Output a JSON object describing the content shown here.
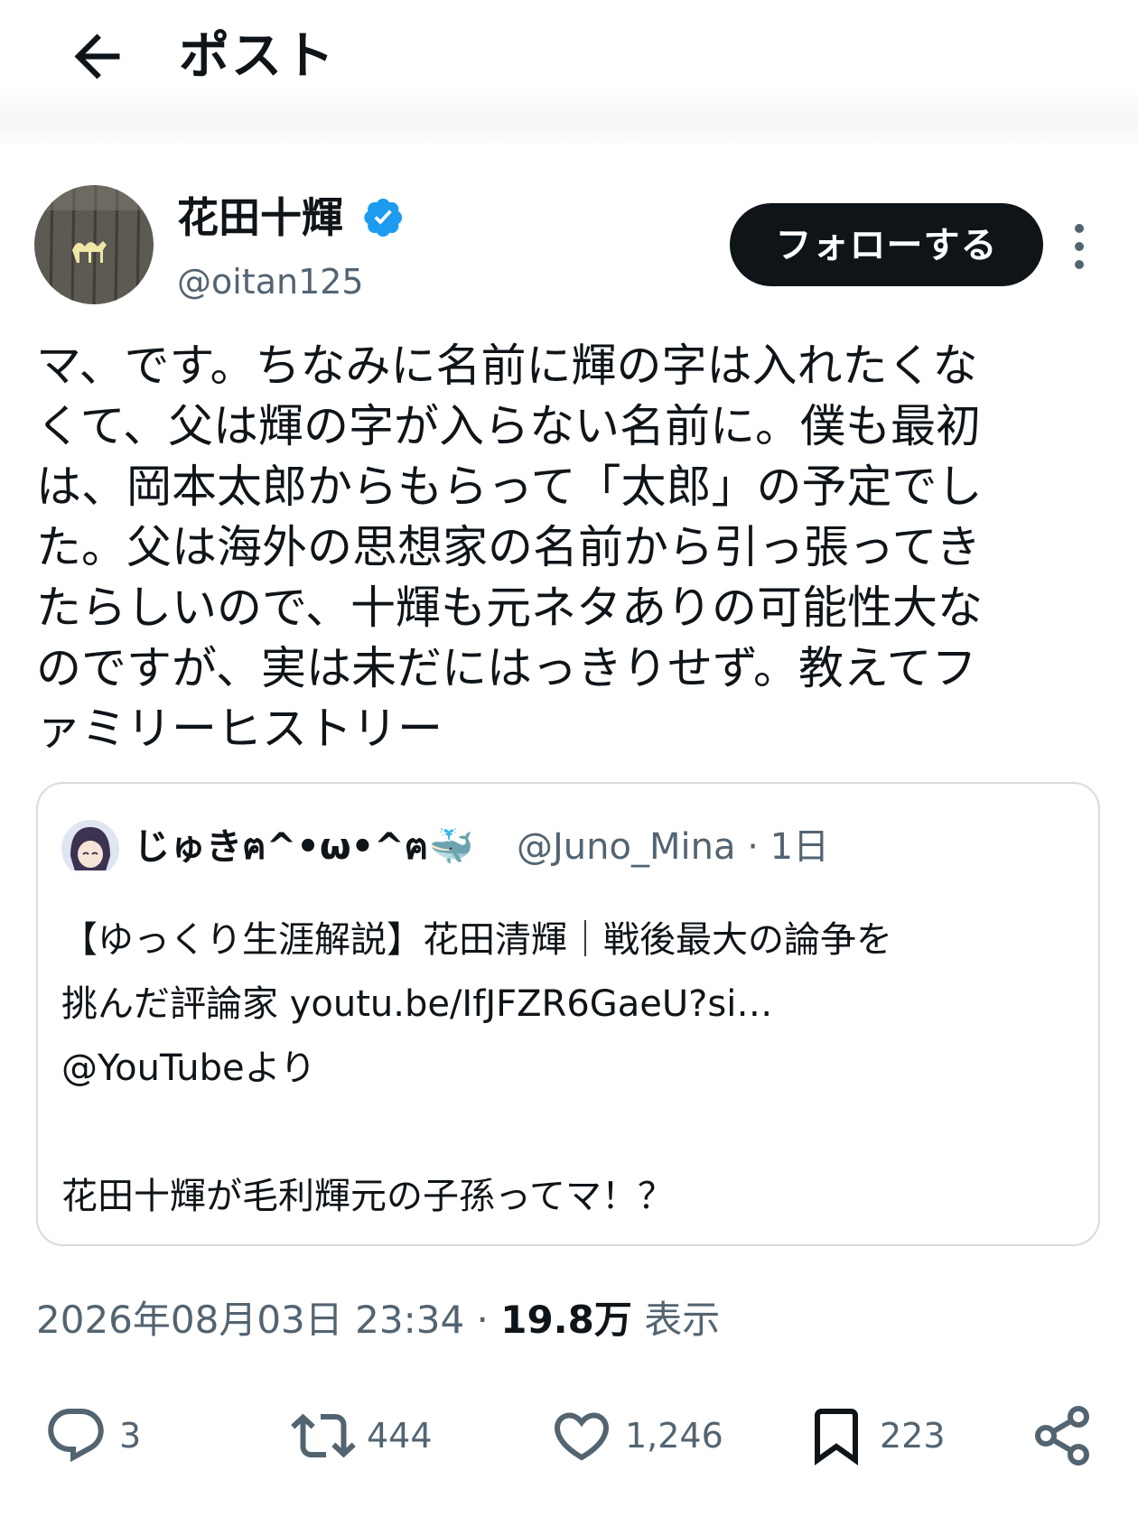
{
  "header": {
    "title": "ポスト"
  },
  "author": {
    "name": "花田十輝",
    "handle": "@oitan125",
    "follow_label": "フォローする"
  },
  "post": {
    "text": "マ、です。ちなみに名前に輝の字は入れたくな\nくて、父は輝の字が入らない名前に。僕も最初\nは、岡本太郎からもらって「太郎」の予定でし\nた。父は海外の思想家の名前から引っ張ってき\nたらしいので、十輝も元ネタありの可能性大な\nのですが、実は未だにはっきりせず。教えてフ\nァミリーヒストリー",
    "date": "2026年08月03日 23:34",
    "views_count": "19.8万",
    "views_label": "表示"
  },
  "quoted": {
    "name": "じゅきฅ^•ω•^ฅ🐳",
    "handle": "@Juno_Mina",
    "time": "1日",
    "text": "【ゆっくり生涯解説】花田清輝｜戦後最大の論争を\n挑んだ評論家 youtu.be/IfJFZR6GaeU?si…\n@YouTubeより\n\n花田十輝が毛利輝元の子孫ってマ！？"
  },
  "actions": {
    "replies": "3",
    "reposts": "444",
    "likes": "1,246",
    "bookmarks": "223"
  },
  "colors": {
    "text": "#0f1419",
    "muted": "#536471",
    "verified": "#1d9bf0"
  }
}
